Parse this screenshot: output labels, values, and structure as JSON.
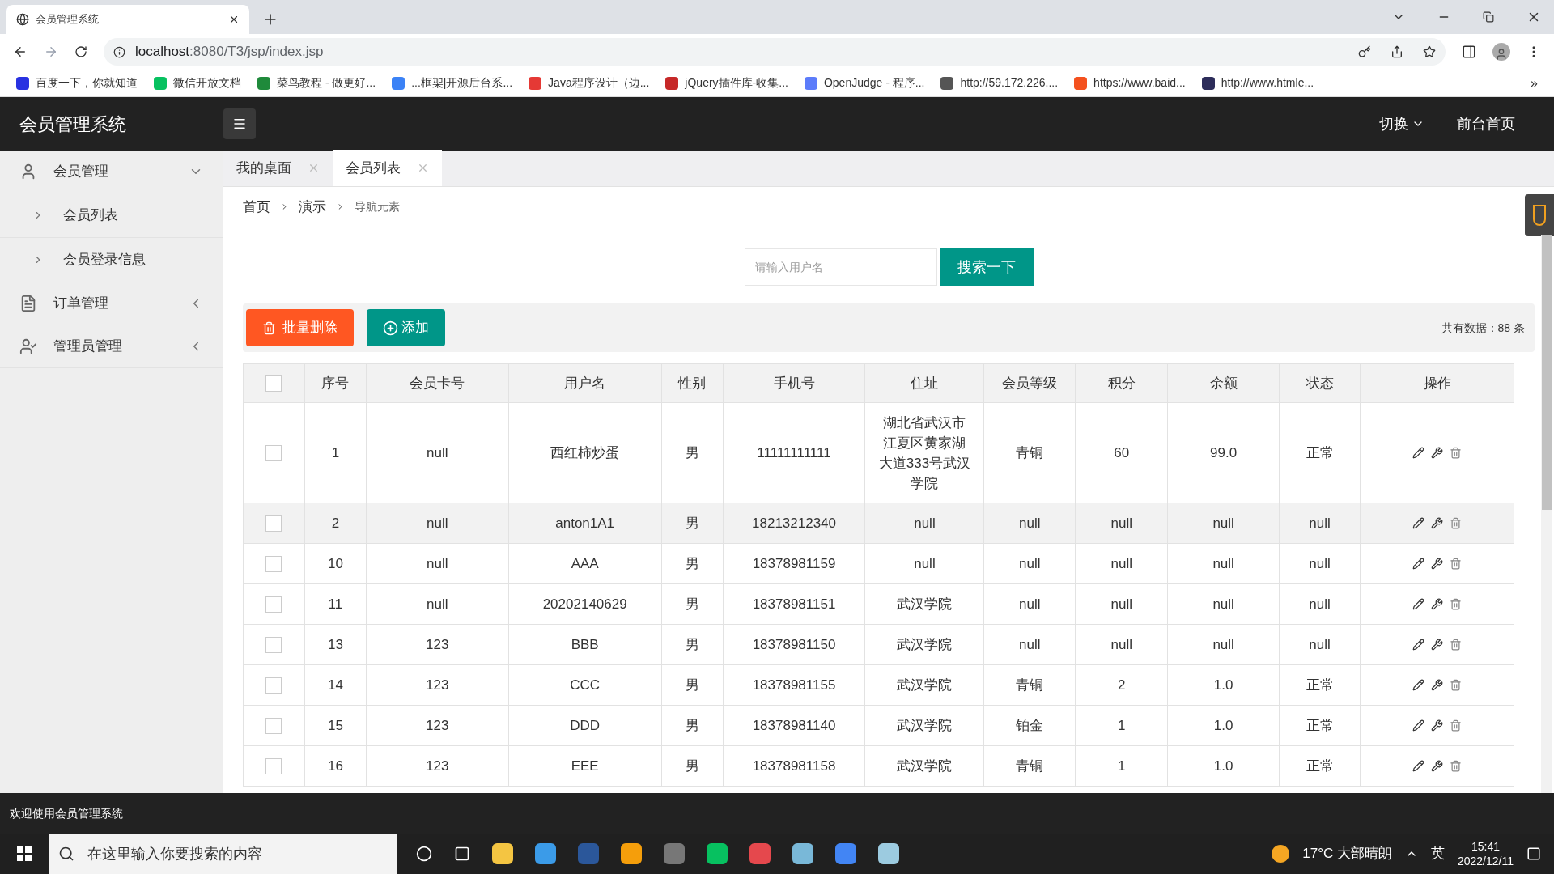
{
  "browser": {
    "tab_title": "会员管理系统",
    "url_host": "localhost",
    "url_rest": ":8080/T3/jsp/index.jsp",
    "bookmarks": [
      {
        "label": "百度一下，你就知道",
        "color": "#2932e1"
      },
      {
        "label": "微信开放文档",
        "color": "#07c160"
      },
      {
        "label": "菜鸟教程 - 做更好...",
        "color": "#1f8a3b"
      },
      {
        "label": "...框架|开源后台系...",
        "color": "#3b82f6"
      },
      {
        "label": "Java程序设计（边...",
        "color": "#e53935"
      },
      {
        "label": "jQuery插件库-收集...",
        "color": "#c62828"
      },
      {
        "label": "OpenJudge - 程序...",
        "color": "#5c7cfa"
      },
      {
        "label": "http://59.172.226....",
        "color": "#555555"
      },
      {
        "label": "https://www.baid...",
        "color": "#f4511e"
      },
      {
        "label": "http://www.htmle...",
        "color": "#2d2d5a"
      }
    ],
    "more": "»"
  },
  "header": {
    "title": "会员管理系统",
    "switch": "切换",
    "home": "前台首页"
  },
  "sidebar": {
    "items": [
      {
        "label": "会员管理",
        "expanded": true,
        "children": [
          {
            "label": "会员列表"
          },
          {
            "label": "会员登录信息"
          }
        ]
      },
      {
        "label": "订单管理",
        "expanded": false
      },
      {
        "label": "管理员管理",
        "expanded": false
      }
    ]
  },
  "tabs": [
    {
      "label": "我的桌面",
      "selected": false
    },
    {
      "label": "会员列表",
      "selected": true
    }
  ],
  "breadcrumb": [
    "首页",
    "演示",
    "导航元素"
  ],
  "search": {
    "placeholder": "请输入用户名",
    "button": "搜索一下"
  },
  "toolbar": {
    "delete": "批量删除",
    "add": "添加",
    "total": "共有数据：88 条"
  },
  "table": {
    "select_all_checked": false,
    "columns": [
      "序号",
      "会员卡号",
      "用户名",
      "性别",
      "手机号",
      "住址",
      "会员等级",
      "积分",
      "余额",
      "状态",
      "操作"
    ],
    "rows": [
      {
        "checked": false,
        "highlighted": false,
        "cells": [
          "1",
          "null",
          "西红柿炒蛋",
          "男",
          "11111111111",
          "湖北省武汉市江夏区黄家湖大道333号武汉学院",
          "青铜",
          "60",
          "99.0",
          "正常"
        ]
      },
      {
        "checked": false,
        "highlighted": true,
        "cells": [
          "2",
          "null",
          "anton1A1",
          "男",
          "18213212340",
          "null",
          "null",
          "null",
          "null",
          "null"
        ]
      },
      {
        "checked": false,
        "highlighted": false,
        "cells": [
          "10",
          "null",
          "AAA",
          "男",
          "18378981159",
          "null",
          "null",
          "null",
          "null",
          "null"
        ]
      },
      {
        "checked": false,
        "highlighted": false,
        "cells": [
          "11",
          "null",
          "20202140629",
          "男",
          "18378981151",
          "武汉学院",
          "null",
          "null",
          "null",
          "null"
        ]
      },
      {
        "checked": false,
        "highlighted": false,
        "cells": [
          "13",
          "123",
          "BBB",
          "男",
          "18378981150",
          "武汉学院",
          "null",
          "null",
          "null",
          "null"
        ]
      },
      {
        "checked": false,
        "highlighted": false,
        "cells": [
          "14",
          "123",
          "CCC",
          "男",
          "18378981155",
          "武汉学院",
          "青铜",
          "2",
          "1.0",
          "正常"
        ]
      },
      {
        "checked": false,
        "highlighted": false,
        "cells": [
          "15",
          "123",
          "DDD",
          "男",
          "18378981140",
          "武汉学院",
          "铂金",
          "1",
          "1.0",
          "正常"
        ]
      },
      {
        "checked": false,
        "highlighted": false,
        "cells": [
          "16",
          "123",
          "EEE",
          "男",
          "18378981158",
          "武汉学院",
          "青铜",
          "1",
          "1.0",
          "正常"
        ]
      }
    ]
  },
  "footer": "欢迎使用会员管理系统",
  "taskbar": {
    "search_placeholder": "在这里输入你要搜索的内容",
    "weather": "17°C 大部晴朗",
    "ime": "英",
    "time": "15:41",
    "date": "2022/12/11"
  }
}
